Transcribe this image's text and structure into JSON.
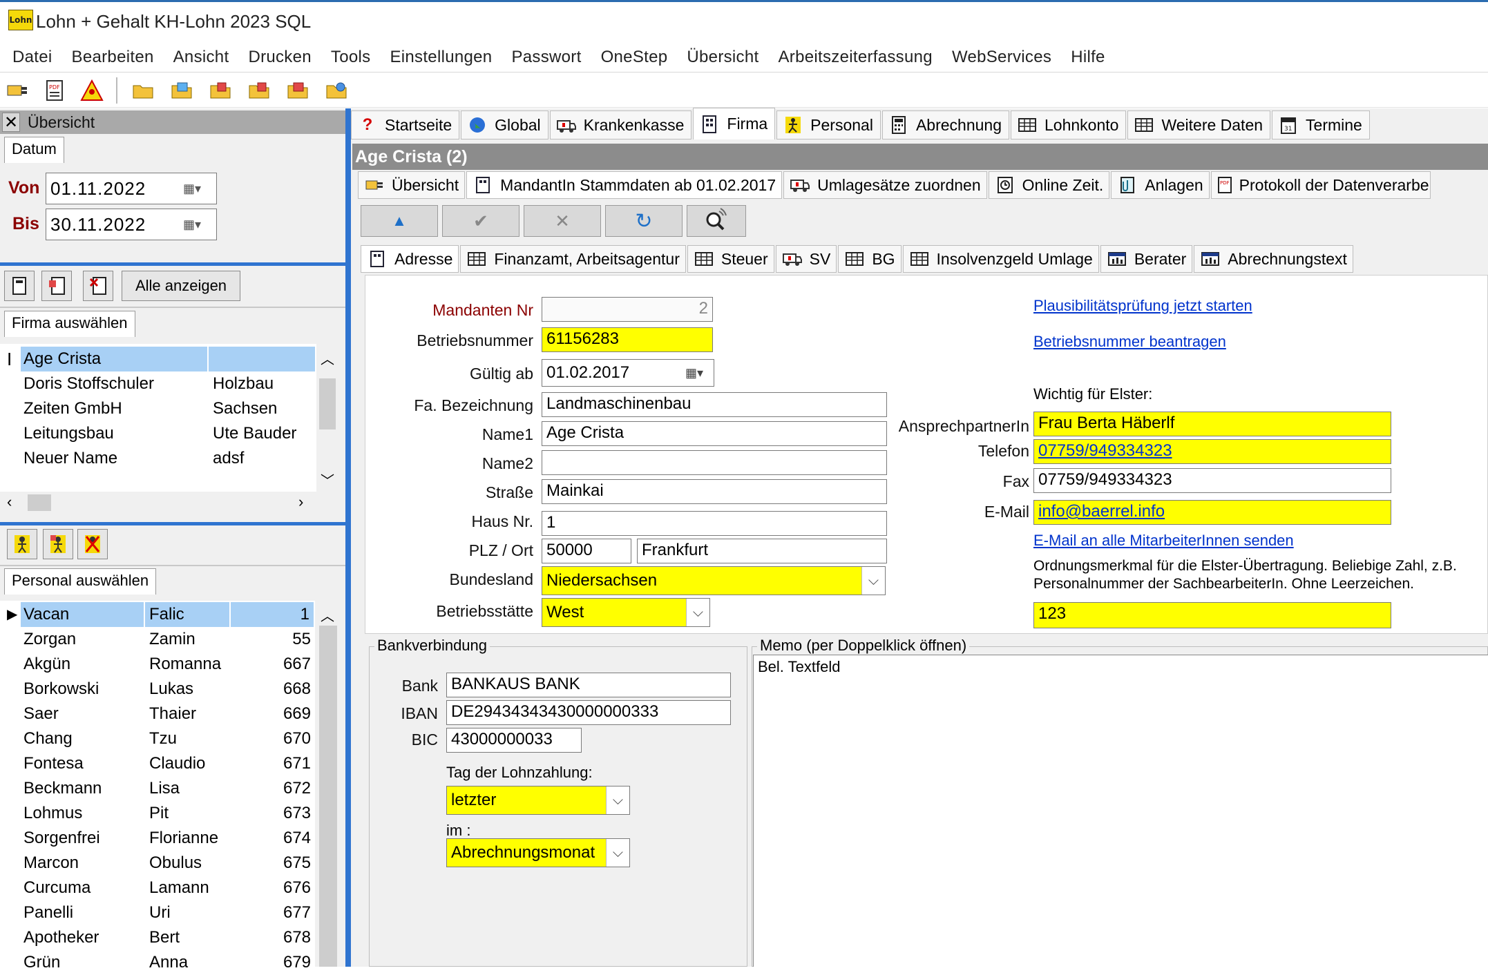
{
  "app": {
    "title": "Lohn + Gehalt KH-Lohn 2023 SQL",
    "logo_text": "Lohn"
  },
  "menu": [
    "Datei",
    "Bearbeiten",
    "Ansicht",
    "Drucken",
    "Tools",
    "Einstellungen",
    "Passwort",
    "OneStep",
    "Übersicht",
    "Arbeitszeiterfassung",
    "WebServices",
    "Hilfe"
  ],
  "left_panel": {
    "title": "Übersicht",
    "date_tab": "Datum",
    "von_label": "Von",
    "von_value": "01.11.2022",
    "bis_label": "Bis",
    "bis_value": "30.11.2022",
    "alle_anzeigen": "Alle anzeigen",
    "firma_tab": "Firma auswählen",
    "firma_rows": [
      {
        "name": "Age Crista",
        "extra": ""
      },
      {
        "name": "Doris Stoffschuler",
        "extra": "Holzbau"
      },
      {
        "name": "Zeiten GmbH",
        "extra": "Sachsen"
      },
      {
        "name": "Leitungsbau",
        "extra": "Ute Bauder"
      },
      {
        "name": "Neuer Name",
        "extra": "adsf"
      }
    ],
    "personal_tab": "Personal auswählen",
    "personal_rows": [
      {
        "last": "Vacan",
        "first": "Falic",
        "nr": "1"
      },
      {
        "last": "Zorgan",
        "first": "Zamin",
        "nr": "55"
      },
      {
        "last": "Akgün",
        "first": "Romanna",
        "nr": "667"
      },
      {
        "last": "Borkowski",
        "first": "Lukas",
        "nr": "668"
      },
      {
        "last": "Saer",
        "first": "Thaier",
        "nr": "669"
      },
      {
        "last": "Chang",
        "first": "Tzu",
        "nr": "670"
      },
      {
        "last": "Fontesa",
        "first": "Claudio",
        "nr": "671"
      },
      {
        "last": "Beckmann",
        "first": "Lisa",
        "nr": "672"
      },
      {
        "last": "Lohmus",
        "first": "Pit",
        "nr": "673"
      },
      {
        "last": "Sorgenfrei",
        "first": "Florianne",
        "nr": "674"
      },
      {
        "last": "Marcon",
        "first": "Obulus",
        "nr": "675"
      },
      {
        "last": "Curcuma",
        "first": "Lamann",
        "nr": "676"
      },
      {
        "last": "Panelli",
        "first": "Uri",
        "nr": "677"
      },
      {
        "last": "Apotheker",
        "first": "Bert",
        "nr": "678"
      },
      {
        "last": "Grün",
        "first": "Anna",
        "nr": "679"
      }
    ]
  },
  "main_tabs": [
    "Startseite",
    "Global",
    "Krankenkasse",
    "Firma",
    "Personal",
    "Abrechnung",
    "Lohnkonto",
    "Weitere Daten",
    "Termine"
  ],
  "firma_header": "Age Crista  (2)",
  "sub_tabs": [
    "Übersicht",
    "MandantIn Stammdaten ab 01.02.2017",
    "Umlagesätze zuordnen",
    "Online Zeit.",
    "Anlagen",
    "Protokoll der Datenverarbeitungsvorgänge"
  ],
  "form_tabs": [
    "Adresse",
    "Finanzamt, Arbeitsagentur",
    "Steuer",
    "SV",
    "BG",
    "Insolvenzgeld Umlage",
    "Berater",
    "Abrechnungstext"
  ],
  "form": {
    "labels": {
      "mandanten_nr": "Mandanten Nr",
      "betriebsnummer": "Betriebsnummer",
      "gueltig_ab": "Gültig ab",
      "fa_bezeichnung": "Fa. Bezeichnung",
      "name1": "Name1",
      "name2": "Name2",
      "strasse": "Straße",
      "haus_nr": "Haus Nr.",
      "plz_ort": "PLZ / Ort",
      "bundesland": "Bundesland",
      "betriebsstaette": "Betriebsstätte"
    },
    "values": {
      "mandanten_nr": "2",
      "betriebsnummer": "61156283",
      "gueltig_ab": "01.02.2017",
      "fa_bezeichnung": "Landmaschinenbau",
      "name1": "Age Crista",
      "name2": "",
      "strasse": "Mainkai",
      "haus_nr": "1",
      "plz": "50000",
      "ort": "Frankfurt",
      "bundesland": "Niedersachsen",
      "betriebsstaette": "West"
    },
    "links": {
      "plausi": "Plausibilitätsprüfung jetzt starten",
      "betriebsnummer": "Betriebsnummer beantragen",
      "email_all": "E-Mail an alle MitarbeiterInnen senden"
    },
    "elster": {
      "heading": "Wichtig für Elster:",
      "ansprechpartner_label": "AnsprechpartnerIn",
      "ansprechpartner": "Frau Berta Häberlf",
      "telefon_label": "Telefon",
      "telefon": "07759/949334323",
      "fax_label": "Fax",
      "fax": "07759/949334323",
      "email_label": "E-Mail",
      "email": "info@baerrel.info",
      "ordnung_text_1": "Ordnungsmerkmal für die Elster-Übertragung. Beliebige Zahl, z.B.",
      "ordnung_text_2": "Personalnummer der SachbearbeiterIn. Ohne Leerzeichen.",
      "ordnung_value": "123"
    }
  },
  "bank": {
    "group_label": "Bankverbindung",
    "bank_label": "Bank",
    "bank": "BANKAUS BANK",
    "iban_label": "IBAN",
    "iban": "DE29434343430000000333",
    "bic_label": "BIC",
    "bic": "43000000033",
    "tag_label": "Tag der Lohnzahlung:",
    "tag": "letzter",
    "im_label": "im :",
    "im": "Abrechnungsmonat"
  },
  "memo": {
    "group_label": "Memo (per Doppelklick öffnen)",
    "text": "Bel. Textfeld"
  },
  "colors": {
    "accent_blue": "#2f74d0",
    "highlight_yellow": "#ffff00",
    "selection_blue": "#a8d0f5",
    "link_blue": "#0033cc"
  }
}
